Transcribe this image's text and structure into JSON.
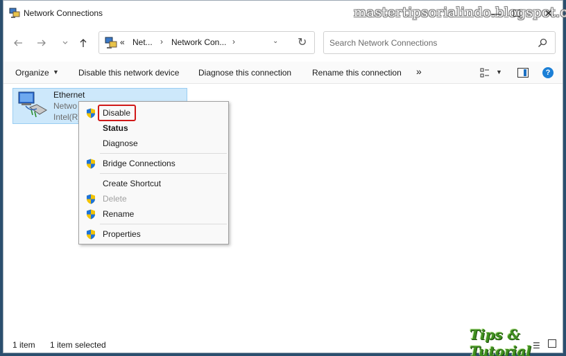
{
  "window": {
    "title": "Network Connections",
    "watermark": "mastertipsorialindo.blogspot.com"
  },
  "controls": {
    "minimize": "—",
    "maximize": "☐",
    "close": "✕"
  },
  "address": {
    "overflow": "«",
    "segments": [
      "Net...",
      "Network Con..."
    ],
    "dropdown": "⌄",
    "refresh": "↻"
  },
  "search": {
    "placeholder": "Search Network Connections"
  },
  "commandbar": {
    "organize": "Organize",
    "disable": "Disable this network device",
    "diagnose": "Diagnose this connection",
    "rename": "Rename this connection",
    "more": "»",
    "help": "?"
  },
  "item": {
    "name": "Ethernet",
    "line2": "Netwo",
    "line3": "Intel(R)"
  },
  "context_menu": {
    "items": [
      {
        "label": "Disable",
        "shield": true,
        "bold": false,
        "disabled": false,
        "highlighted": true
      },
      {
        "label": "Status",
        "shield": false,
        "bold": true,
        "disabled": false
      },
      {
        "label": "Diagnose",
        "shield": false,
        "bold": false,
        "disabled": false
      },
      {
        "label": "Bridge Connections",
        "shield": true,
        "bold": false,
        "disabled": false
      },
      {
        "label": "Create Shortcut",
        "shield": false,
        "bold": false,
        "disabled": false
      },
      {
        "label": "Delete",
        "shield": true,
        "bold": false,
        "disabled": true
      },
      {
        "label": "Rename",
        "shield": true,
        "bold": false,
        "disabled": false
      },
      {
        "label": "Properties",
        "shield": true,
        "bold": false,
        "disabled": false
      }
    ]
  },
  "statusbar": {
    "count": "1 item",
    "selected": "1 item selected",
    "logo": "Tips & Tutorial"
  },
  "colors": {
    "highlight_box": "#d01818",
    "selection_bg": "#cde8fb",
    "accent": "#1b7fd6"
  }
}
